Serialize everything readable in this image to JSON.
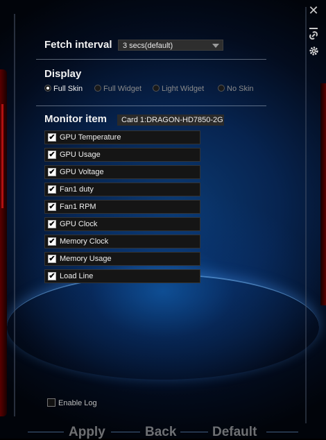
{
  "fetch_interval": {
    "label": "Fetch interval",
    "value": "3 secs(default)"
  },
  "display": {
    "label": "Display",
    "options": [
      {
        "label": "Full Skin",
        "selected": true
      },
      {
        "label": "Full Widget",
        "selected": false
      },
      {
        "label": "Light Widget",
        "selected": false
      },
      {
        "label": "No Skin",
        "selected": false
      }
    ]
  },
  "monitor": {
    "label": "Monitor item",
    "card": "Card 1:DRAGON-HD7850-2G",
    "items": [
      {
        "label": "GPU Temperature",
        "checked": true
      },
      {
        "label": "GPU Usage",
        "checked": true
      },
      {
        "label": "GPU Voltage",
        "checked": true
      },
      {
        "label": "Fan1 duty",
        "checked": true
      },
      {
        "label": "Fan1 RPM",
        "checked": true
      },
      {
        "label": "GPU Clock",
        "checked": true
      },
      {
        "label": "Memory Clock",
        "checked": true
      },
      {
        "label": "Memory Usage",
        "checked": true
      },
      {
        "label": "Load Line",
        "checked": true
      }
    ]
  },
  "enable_log": {
    "label": "Enable Log",
    "checked": false
  },
  "buttons": {
    "apply": "Apply",
    "back": "Back",
    "default": "Default"
  },
  "icons": {
    "close": "close-icon",
    "link": "link-icon",
    "settings": "gear-icon",
    "minimize": "minimize-icon"
  }
}
